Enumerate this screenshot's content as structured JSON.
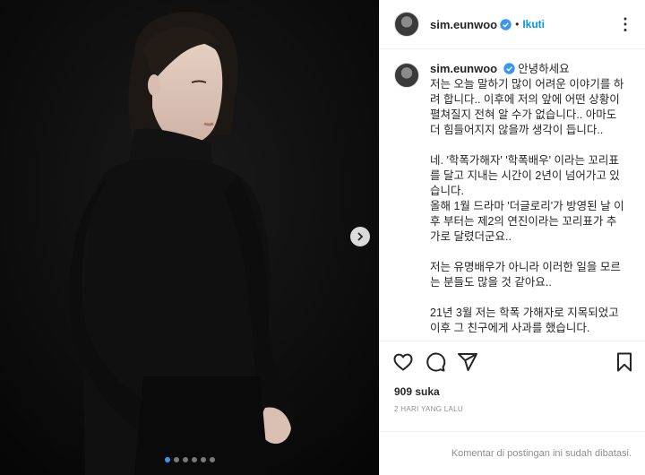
{
  "post": {
    "username": "sim.eunwoo",
    "separator": "•",
    "follow_label": "Ikuti",
    "more_icon": "more-horizontal-icon",
    "verified_color": "#3897f0"
  },
  "caption": {
    "username": "sim.eunwoo",
    "lines": [
      "안녕하세요",
      "저는 오늘 말하기 많이 어려운 이야기를 하려 합니다.. 이후에 저의 앞에 어떤 상황이 펼쳐질지 전혀 알 수가 없습니다.. 아마도 더 힘들어지지 않을까 생각이 듭니다..",
      "",
      "네. '학폭가해자' '학폭배우' 이라는 꼬리표를 달고 지내는 시간이 2년이 넘어가고 있습니다.",
      "올해 1월 드라마 '더글로리'가 방영된 날 이후 부터는 제2의 연진이라는 꼬리표가 추가로 달렸더군요..",
      "",
      "저는 유명배우가 아니라 이러한 일을 모르는 분들도 많을 것 같아요..",
      "",
      "21년 3월 저는 학폭 가해자로 지목되었고",
      "이후 그 친구에게 사과를 했습니다."
    ]
  },
  "actions": {
    "like_icon": "heart-icon",
    "comment_icon": "comment-icon",
    "share_icon": "share-icon",
    "save_icon": "bookmark-icon"
  },
  "likes": {
    "count": "909",
    "label": "suka"
  },
  "date": "2 HARI YANG LALU",
  "comments_disabled": "Komentar di postingan ini sudah dibatasi.",
  "carousel": {
    "slide_count": 6,
    "active_index": 0,
    "next_icon": "chevron-right-icon"
  }
}
